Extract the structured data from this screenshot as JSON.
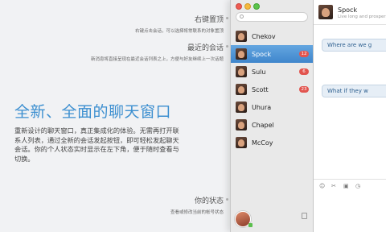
{
  "annotations": [
    {
      "title": "右键置顶",
      "desc": "右键点击会话，可以选择将常联系的对象置顶"
    },
    {
      "title": "最近的会话",
      "desc": "新消息将直接呈现在最近会话列表之上，方便与好友继续上一次话题"
    },
    {
      "title": "你的状态",
      "desc": "查看或修改当前的帐号状态"
    }
  ],
  "headline": "全新、全面的聊天窗口",
  "body_text": "重新设计的聊天窗口，真正集成化的体验。无需再打开联系人列表，通过全新的会话发起按钮，即可轻松发起聊天会话。你的个人状态实时显示在左下角，便于随时查看与切换。",
  "contacts": [
    {
      "name": "Chekov",
      "badge": ""
    },
    {
      "name": "Spock",
      "badge": "12"
    },
    {
      "name": "Sulu",
      "badge": "6"
    },
    {
      "name": "Scott",
      "badge": "23"
    },
    {
      "name": "Uhura",
      "badge": ""
    },
    {
      "name": "Chapel",
      "badge": ""
    },
    {
      "name": "McCoy",
      "badge": ""
    }
  ],
  "chat": {
    "name": "Spock",
    "status": "Live long and prosper",
    "messages": [
      "Where are we g",
      "What if they w"
    ]
  },
  "toolbar_icons": [
    "smiley-icon",
    "scissors-icon",
    "image-icon",
    "clock-icon"
  ],
  "colors": {
    "accent": "#3c8fd0",
    "selected_row": "#4a8fd1",
    "badge": "#e2544e"
  }
}
